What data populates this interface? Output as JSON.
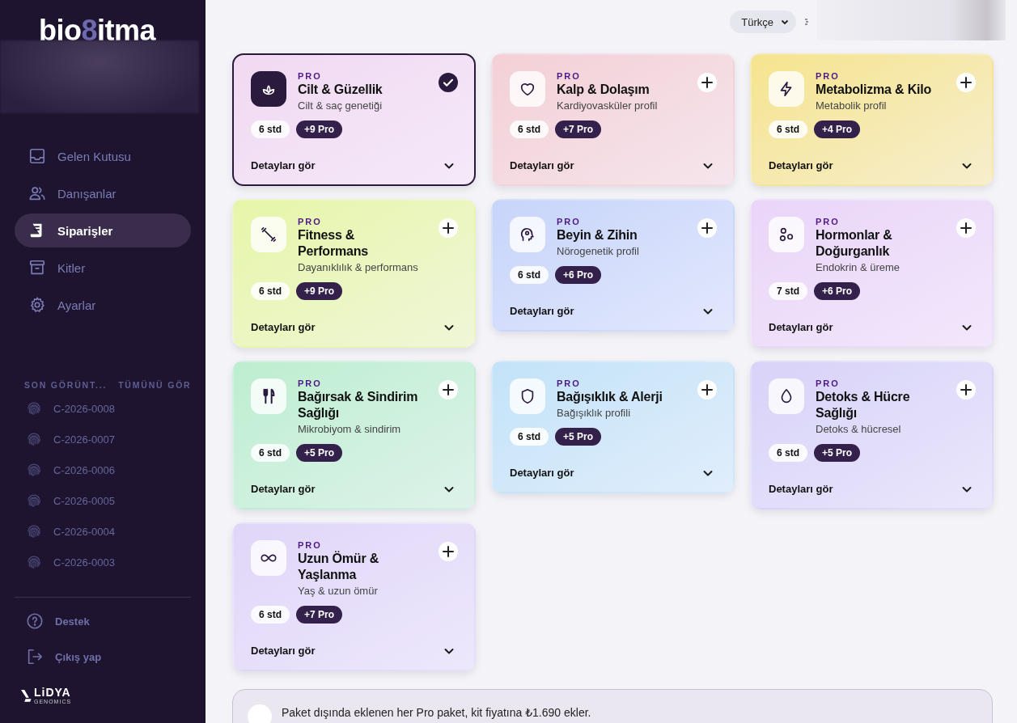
{
  "sidebar": {
    "logo": [
      "bio",
      "8",
      "itma"
    ],
    "nav": [
      {
        "label": "Gelen Kutusu",
        "selected": false
      },
      {
        "label": "Danışanlar",
        "selected": false
      },
      {
        "label": "Siparişler",
        "selected": true
      },
      {
        "label": "Kitler",
        "selected": false
      },
      {
        "label": "Ayarlar",
        "selected": false
      }
    ],
    "recent": {
      "title": "SON GÖRÜNT...",
      "link": "TÜMÜNÜ GÖR",
      "items": [
        "C-2026-0008",
        "C-2026-0007",
        "C-2026-0006",
        "C-2026-0005",
        "C-2026-0004",
        "C-2026-0003"
      ]
    },
    "footer": [
      "Destek",
      "Çıkış yap"
    ],
    "brand": {
      "name": "LiDYA",
      "sub": "GENOMICS"
    }
  },
  "topbar": {
    "language": "Türkçe"
  },
  "packages": [
    {
      "badge": "PRO",
      "title": "Cilt & Güzellik",
      "subtitle": "Cilt & saç genetiği",
      "std": "6 std",
      "pro": "+9 Pro",
      "details": "Detayları gör",
      "selected": true,
      "color": "#f1d9f2"
    },
    {
      "badge": "PRO",
      "title": "Kalp & Dolaşım",
      "subtitle": "Kardiyovasküler profil",
      "std": "6 std",
      "pro": "+7 Pro",
      "details": "Detayları gör",
      "selected": false,
      "color": "#f3d0d6"
    },
    {
      "badge": "PRO",
      "title": "Metabolizma & Kilo",
      "subtitle": "Metabolik profil",
      "std": "6 std",
      "pro": "+4 Pro",
      "details": "Detayları gör",
      "selected": false,
      "color": "#f5e48e"
    },
    {
      "badge": "PRO",
      "title": "Fitness & Performans",
      "subtitle": "Dayanıklılık & performans",
      "std": "6 std",
      "pro": "+9 Pro",
      "details": "Detayları gör",
      "selected": false,
      "color": "#e6f6a8"
    },
    {
      "badge": "PRO",
      "title": "Beyin & Zihin",
      "subtitle": "Nörogenetik profil",
      "std": "6 std",
      "pro": "+6 Pro",
      "details": "Detayları gör",
      "selected": false,
      "color": "#c7d5fa"
    },
    {
      "badge": "PRO",
      "title": "Hormonlar & Doğurganlık",
      "subtitle": "Endokrin & üreme",
      "std": "7 std",
      "pro": "+6 Pro",
      "details": "Detayları gör",
      "selected": false,
      "color": "#ead5f8"
    },
    {
      "badge": "PRO",
      "title": "Bağırsak & Sindirim Sağlığı",
      "subtitle": "Mikrobiyom & sindirim",
      "std": "6 std",
      "pro": "+5 Pro",
      "details": "Detayları gör",
      "selected": false,
      "color": "#bdeed0"
    },
    {
      "badge": "PRO",
      "title": "Bağışıklık & Alerji",
      "subtitle": "Bağışıklık profili",
      "std": "6 std",
      "pro": "+5 Pro",
      "details": "Detayları gör",
      "selected": false,
      "color": "#c3e3f8"
    },
    {
      "badge": "PRO",
      "title": "Detoks & Hücre Sağlığı",
      "subtitle": "Detoks & hücresel",
      "std": "6 std",
      "pro": "+5 Pro",
      "details": "Detayları gör",
      "selected": false,
      "color": "#d8d3f8"
    },
    {
      "badge": "PRO",
      "title": "Uzun Ömür & Yaşlanma",
      "subtitle": "Yaş & uzun ömür",
      "std": "6 std",
      "pro": "+7 Pro",
      "details": "Detayları gör",
      "selected": false,
      "color": "#e0d6f8"
    }
  ],
  "note": "Paket dışında eklenen her Pro paket, kit fiyatına ₺1.690 ekler."
}
